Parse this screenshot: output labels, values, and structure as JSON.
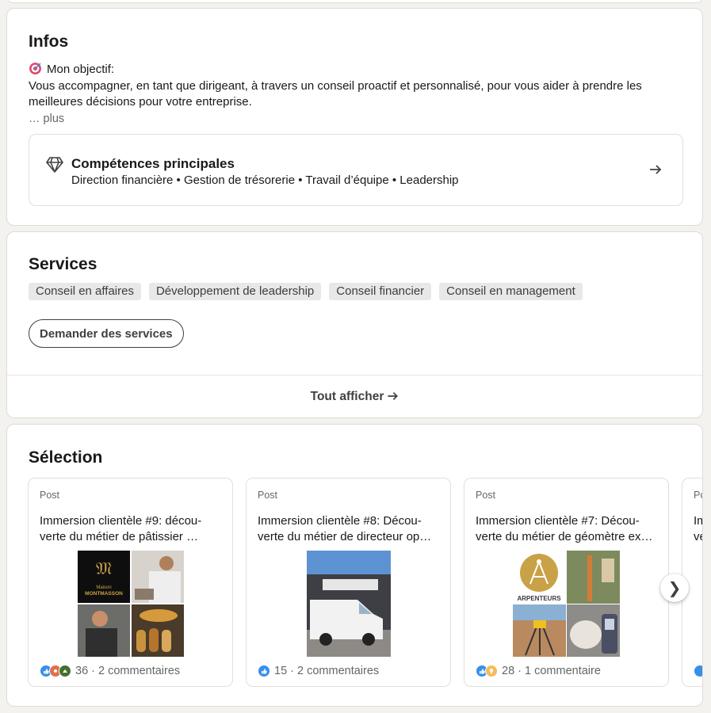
{
  "infos": {
    "title": "Infos",
    "objective_label": "Mon objectif:",
    "objective_text": "Vous accompagner, en tant que dirigeant, à travers un conseil proactif et personnalisé, pour vous aider à prendre les meilleures décisions pour votre entreprise.",
    "more": "… plus",
    "skills_title": "Compétences principales",
    "skills": "Direction financière • Gestion de trésorerie • Travail d’équipe • Leadership"
  },
  "services": {
    "title": "Services",
    "chips": [
      "Conseil en affaires",
      "Développement de leadership",
      "Conseil financier",
      "Conseil en management"
    ],
    "request_button": "Demander des services",
    "show_all": "Tout afficher"
  },
  "selection": {
    "title": "Sélection",
    "posts": [
      {
        "type": "Post",
        "text": "Immersion clientèle #9: décou-\nverte du métier de pâtissier …",
        "stats": "36 · 2 commentaires",
        "reactions": [
          "like",
          "celebrate",
          "support"
        ],
        "image": "maison-montmasson-collage"
      },
      {
        "type": "Post",
        "text": "Immersion clientèle #8: Décou-\nverte du métier de directeur op…",
        "stats": "15 · 2 commentaires",
        "reactions": [
          "like"
        ],
        "image": "van-photo"
      },
      {
        "type": "Post",
        "text": "Immersion clientèle #7: Décou-\nverte du métier de géomètre ex…",
        "stats": "28 · 1 commentaire",
        "reactions": [
          "like",
          "insightful"
        ],
        "image": "arpenteurs-collage"
      },
      {
        "type": "Po",
        "text": "Im\nve",
        "stats": "",
        "reactions": [
          "like"
        ],
        "image": ""
      }
    ],
    "next_icon": "chevron-right-icon"
  },
  "colors": {
    "like": "#378fe9",
    "celebrate": "#44712e",
    "support": "#df704d",
    "insightful": "#f5bb5c",
    "gold": "#c9a146"
  }
}
